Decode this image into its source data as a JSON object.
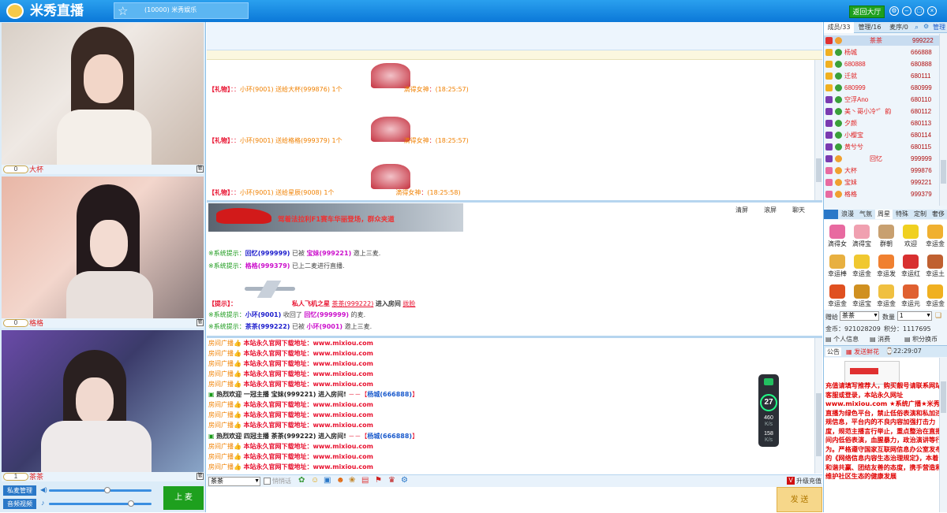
{
  "app": {
    "title": "米秀直播",
    "room": "(10000) 米秀娱乐",
    "lobby": "返回大厅"
  },
  "colors": {
    "titlebar": "#0b78d8",
    "accent_green": "#1ea01e",
    "gift_red": "#e8102e",
    "gift_orange": "#f08000"
  },
  "videos": [
    {
      "name": "大杯",
      "count": "0"
    },
    {
      "name": "格格",
      "count": "0"
    },
    {
      "name": "茶茶",
      "count": "1"
    }
  ],
  "controls": {
    "mic_manage": "私麦管理",
    "audio_video": "音频视频",
    "up_mic": "上 麦"
  },
  "chat": {
    "gifts": [
      {
        "tag": "【礼物】",
        "sep": "：：",
        "sender": "小环(9001)",
        "action": "送给大杯(999876)",
        "qty": "1个",
        "gift": "滴得女神",
        "time": "(18:25:57)"
      },
      {
        "tag": "【礼物】",
        "sep": "：：",
        "sender": "小环(9001)",
        "action": "送给格格(999379)",
        "qty": "1个",
        "gift": "滴得女神",
        "time": "(18:25:57)"
      },
      {
        "tag": "【礼物】",
        "sep": "：：",
        "sender": "小环(9001)",
        "action": "送给星辰(9008)",
        "qty": "1个",
        "gift": "滴得女神",
        "time": "(18:25:58)"
      }
    ],
    "clear": "清屏",
    "scroll": "滚屏",
    "private_chat": "聊天",
    "banner": "驾着法拉利F1赛车华丽登场，群众夹道"
  },
  "system": [
    {
      "prefix": "※系统提示：",
      "a": "回忆(999999)",
      "mid": "已被",
      "b": "宝妹(999221)",
      "end": "邀上三麦."
    },
    {
      "prefix": "※系统提示：",
      "a": "格格(999379)",
      "mid": "已上二麦进行直播.",
      "b": "",
      "end": ""
    },
    {
      "prefix": "【提示】：",
      "a": "私人飞机之星",
      "mid": "茶茶(999222)",
      "b": "进入房间",
      "end": "拢脸"
    },
    {
      "prefix": "※系统提示：",
      "a": "小环(9001)",
      "mid": "收回了",
      "b": "回忆(999999)",
      "end": "的麦."
    },
    {
      "prefix": "※系统提示：",
      "a": "茶茶(999222)",
      "mid": "已被",
      "b": "小环(9001)",
      "end": "邀上三麦."
    }
  ],
  "broadcast": {
    "label": "房间广播",
    "msg": "本站永久官网下载地址：www.mixiou.com",
    "welcome1": "热烈欢迎 一冠主播 宝妹(999221) 进入房间!",
    "welcome2": "热烈欢迎 四冠主播 茶茶(999222) 进入房间!",
    "dash": "－－【",
    "guard": "杨城(666888)",
    "close": "】"
  },
  "net": {
    "score": "27",
    "down": "460",
    "down_unit": "K/s",
    "up": "158",
    "up_unit": "K/s"
  },
  "input": {
    "sender": "茶茶",
    "whisper": "悄悄话",
    "upgrade": "升级充值",
    "send": "发 送"
  },
  "users": {
    "tabs": [
      "成员/33",
      "管理/16",
      "麦序/0"
    ],
    "manage": "管理",
    "list": [
      {
        "name": "茶茶",
        "id": "999222"
      },
      {
        "name": "杨城",
        "id": "666888"
      },
      {
        "name": "680888",
        "id": "680888"
      },
      {
        "name": "迁就",
        "id": "680111"
      },
      {
        "name": "680999",
        "id": "680999"
      },
      {
        "name": "空浮Ano",
        "id": "680110"
      },
      {
        "name": "美丶哥小冷°゜韵",
        "id": "680112"
      },
      {
        "name": "夕颜",
        "id": "680113"
      },
      {
        "name": "小樱宝",
        "id": "680114"
      },
      {
        "name": "黄兮兮",
        "id": "680115"
      },
      {
        "name": "回忆",
        "id": "999999"
      },
      {
        "name": "大杯",
        "id": "999876"
      },
      {
        "name": "宝妹",
        "id": "999221"
      },
      {
        "name": "格格",
        "id": "999379"
      }
    ]
  },
  "gifts_panel": {
    "tabs": [
      "浪漫",
      "气氛",
      "周星",
      "特殊",
      "定制",
      "奢侈"
    ],
    "items": [
      "滴得女",
      "滴得宝",
      "群朝",
      "欢迎",
      "幸运金",
      "幸运棒",
      "幸运金",
      "幸运发",
      "幸运红",
      "幸运土",
      "幸运金",
      "幸运宝",
      "幸运金",
      "幸运元",
      "幸运金"
    ],
    "gift_label": "赠给",
    "gift_to": "茶茶",
    "qty_label": "数量",
    "qty": "1",
    "coins": "金币：921028209",
    "points": "积分：1117695",
    "profile": "个人信息",
    "news": "消费",
    "exchange": "积分换币"
  },
  "notice_panel": {
    "tab": "公告",
    "send_flowers": "发送鲜花",
    "clock": "22:29:07",
    "text": "充值请填写推荐人，购买靓号请联系网站客服或登录，本站永久网址www.mixiou.com ★系统广播★米秀直播为绿色平台，禁止低俗表演和私加违规信息，平台内的不良内容加强打击力度，规范主播言行举止，重点整治在直播间内低俗表演，血腥暴力，政治演讲等行为。严格遵守国家互联网信息办公室发布的《网络信息内容生态治理规定》，本着和谐共赢、团结友善的态度，携手营造和维护社区生态的健康发展"
  }
}
